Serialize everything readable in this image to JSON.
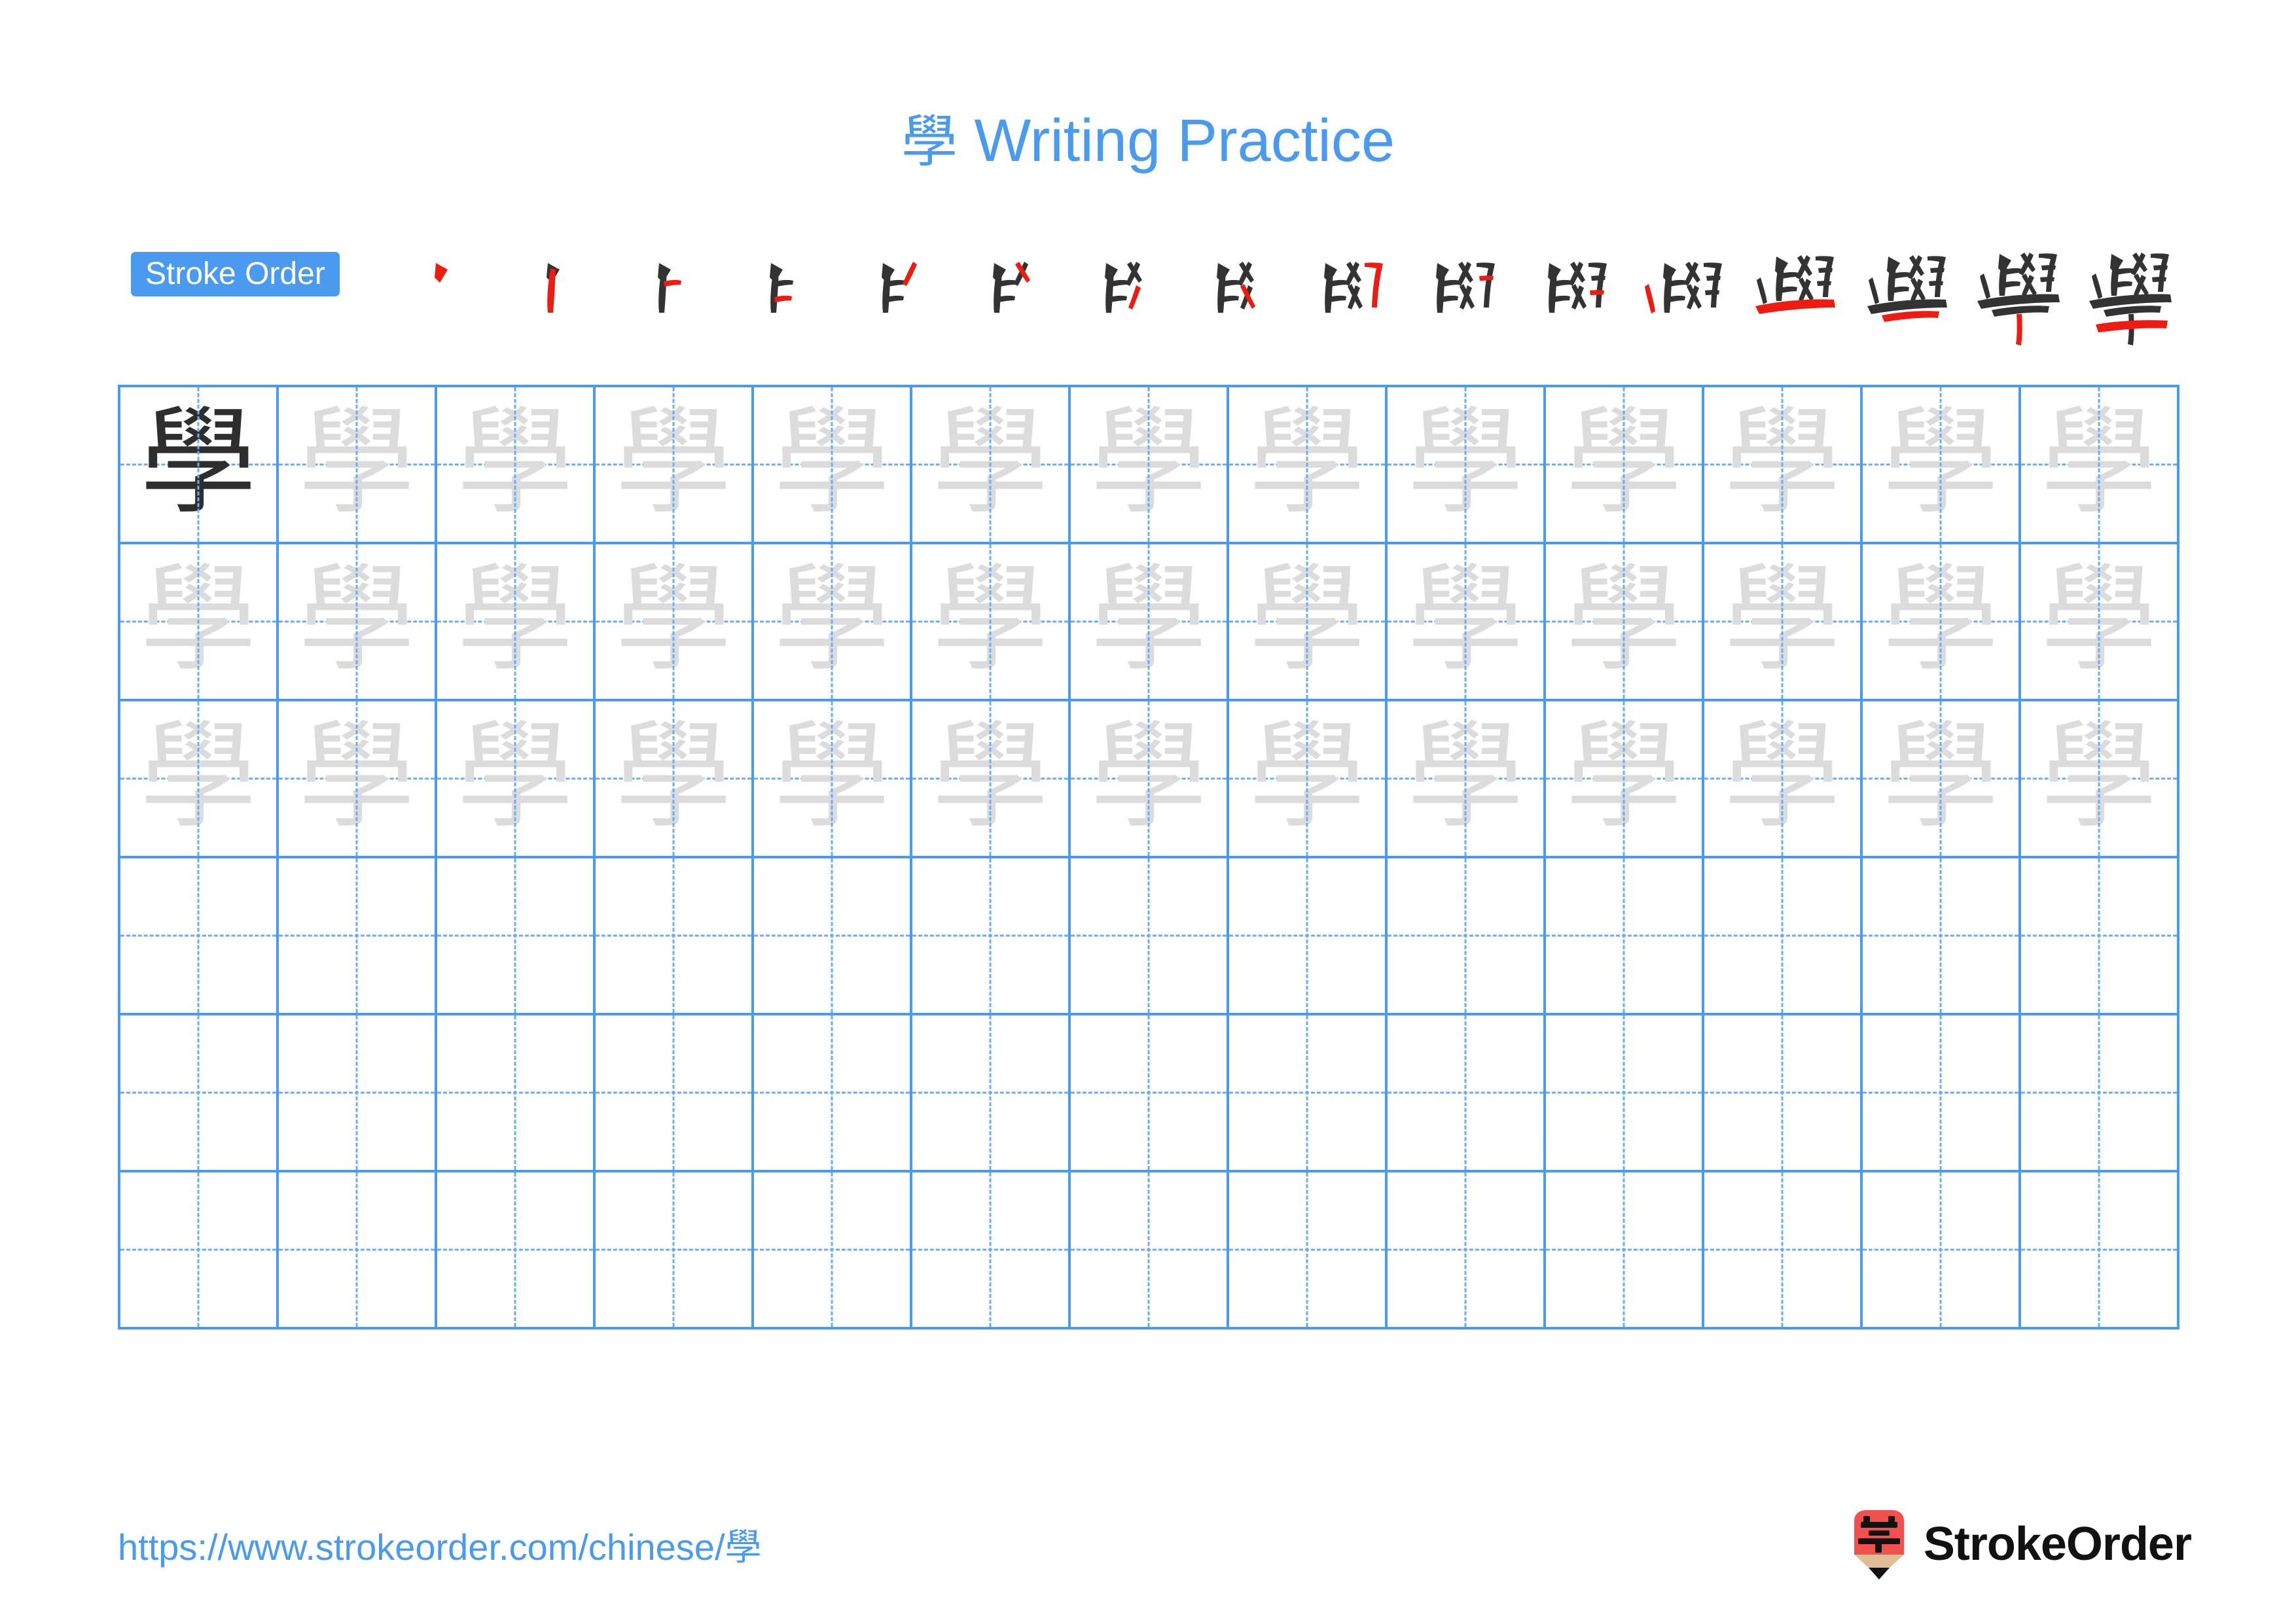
{
  "page": {
    "character": "學",
    "title_suffix": " Writing Practice",
    "title_full": "學 Writing Practice",
    "accent_color": "#4A9BF0",
    "grid_line_color": "#4A9BF0",
    "guide_line_color": "#69AEF5",
    "trace_char_color": "#DCDCDC",
    "ink_char_color": "#2E2E2E",
    "new_stroke_color": "#EE1B11",
    "existing_stroke_color": "#333333"
  },
  "stroke_order": {
    "badge_label": "Stroke Order",
    "total_strokes": 16,
    "steps": [
      {
        "index": 1,
        "name": "stroke-step-1"
      },
      {
        "index": 2,
        "name": "stroke-step-2"
      },
      {
        "index": 3,
        "name": "stroke-step-3"
      },
      {
        "index": 4,
        "name": "stroke-step-4"
      },
      {
        "index": 5,
        "name": "stroke-step-5"
      },
      {
        "index": 6,
        "name": "stroke-step-6"
      },
      {
        "index": 7,
        "name": "stroke-step-7"
      },
      {
        "index": 8,
        "name": "stroke-step-8"
      },
      {
        "index": 9,
        "name": "stroke-step-9"
      },
      {
        "index": 10,
        "name": "stroke-step-10"
      },
      {
        "index": 11,
        "name": "stroke-step-11"
      },
      {
        "index": 12,
        "name": "stroke-step-12"
      },
      {
        "index": 13,
        "name": "stroke-step-13"
      },
      {
        "index": 14,
        "name": "stroke-step-14"
      },
      {
        "index": 15,
        "name": "stroke-step-15"
      },
      {
        "index": 16,
        "name": "stroke-step-16"
      }
    ]
  },
  "practice_grid": {
    "columns": 13,
    "rows": 6,
    "rows_data": [
      {
        "row": 1,
        "cells": [
          "學",
          "學",
          "學",
          "學",
          "學",
          "學",
          "學",
          "學",
          "學",
          "學",
          "學",
          "學",
          "學"
        ],
        "ink_index": 0
      },
      {
        "row": 2,
        "cells": [
          "學",
          "學",
          "學",
          "學",
          "學",
          "學",
          "學",
          "學",
          "學",
          "學",
          "學",
          "學",
          "學"
        ],
        "ink_index": -1
      },
      {
        "row": 3,
        "cells": [
          "學",
          "學",
          "學",
          "學",
          "學",
          "學",
          "學",
          "學",
          "學",
          "學",
          "學",
          "學",
          "學"
        ],
        "ink_index": -1
      },
      {
        "row": 4,
        "cells": [
          "",
          "",
          "",
          "",
          "",
          "",
          "",
          "",
          "",
          "",
          "",
          "",
          ""
        ],
        "ink_index": -1
      },
      {
        "row": 5,
        "cells": [
          "",
          "",
          "",
          "",
          "",
          "",
          "",
          "",
          "",
          "",
          "",
          "",
          ""
        ],
        "ink_index": -1
      },
      {
        "row": 6,
        "cells": [
          "",
          "",
          "",
          "",
          "",
          "",
          "",
          "",
          "",
          "",
          "",
          "",
          ""
        ],
        "ink_index": -1
      }
    ]
  },
  "footer": {
    "url": "https://www.strokeorder.com/chinese/學",
    "brand_name": "StrokeOrder",
    "logo_char": "字",
    "logo_body_color": "#F0514E",
    "logo_wood_color": "#E0BE95",
    "logo_tip_color": "#111111"
  }
}
